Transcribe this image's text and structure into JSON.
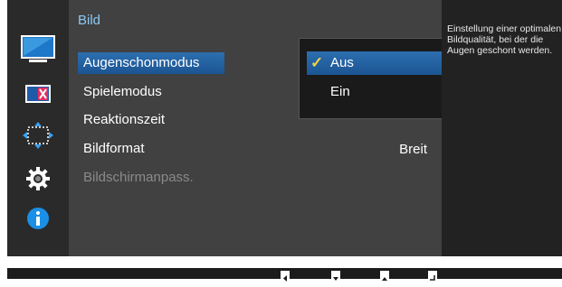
{
  "menu": {
    "title": "Bild",
    "items": [
      {
        "label": "Augenschonmodus",
        "value": "",
        "selected": true,
        "disabled": false
      },
      {
        "label": "Spielemodus",
        "value": "",
        "selected": false,
        "disabled": false
      },
      {
        "label": "Reaktionszeit",
        "value": "",
        "selected": false,
        "disabled": false
      },
      {
        "label": "Bildformat",
        "value": "Breit",
        "selected": false,
        "disabled": false
      },
      {
        "label": "Bildschirmanpass.",
        "value": "",
        "selected": false,
        "disabled": true
      }
    ]
  },
  "submenu": {
    "options": [
      {
        "label": "Aus",
        "checked": true
      },
      {
        "label": "Ein",
        "checked": false
      }
    ]
  },
  "help": {
    "text": "Einstellung einer optimalen Bildqualität, bei der die Augen geschont werden."
  },
  "sidebar": {
    "icons": [
      "picture-icon",
      "color-icon",
      "size-position-icon",
      "settings-gear-icon",
      "info-icon"
    ]
  },
  "bottom_bar": {
    "buttons": [
      "left-button-icon",
      "down-button-icon",
      "up-button-icon",
      "enter-button-icon"
    ]
  },
  "colors": {
    "title": "#8ec8f2",
    "highlight": "#2d6fb0",
    "check": "#f2d23c",
    "info": "#1a8fe6"
  }
}
